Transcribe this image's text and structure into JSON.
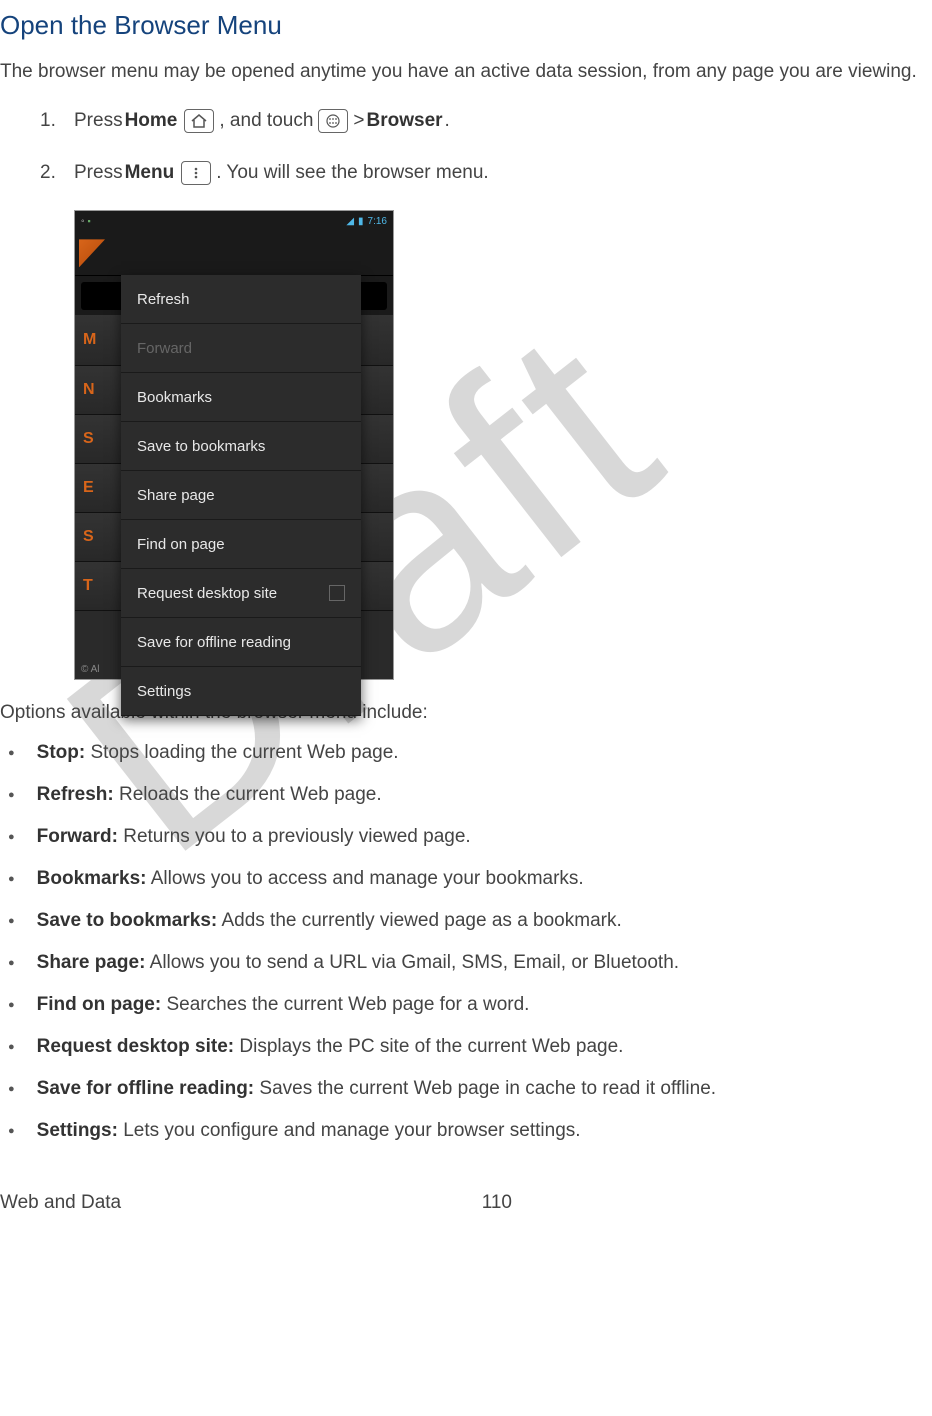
{
  "heading": "Open the Browser Menu",
  "intro": "The browser menu may be opened anytime you have an active data session, from any page you are viewing.",
  "steps": [
    {
      "num": "1.",
      "parts": [
        "Press ",
        {
          "bold": "Home"
        },
        " ",
        {
          "icon": "home"
        },
        ", and touch ",
        {
          "icon": "apps"
        },
        " > ",
        {
          "bold": "Browser"
        },
        "."
      ]
    },
    {
      "num": "2.",
      "parts": [
        "Press ",
        {
          "bold": "Menu"
        },
        " ",
        {
          "icon": "menu"
        },
        ". You will see the browser menu."
      ]
    }
  ],
  "screenshot": {
    "status_time": "7:16",
    "menu_items": [
      {
        "label": "Refresh",
        "disabled": false
      },
      {
        "label": "Forward",
        "disabled": true
      },
      {
        "label": "Bookmarks",
        "disabled": false
      },
      {
        "label": "Save to bookmarks",
        "disabled": false
      },
      {
        "label": "Share page",
        "disabled": false
      },
      {
        "label": "Find on page",
        "disabled": false
      },
      {
        "label": "Request desktop site",
        "disabled": false,
        "checkbox": true
      },
      {
        "label": "Save for offline reading",
        "disabled": false
      },
      {
        "label": "Settings",
        "disabled": false
      }
    ],
    "bg_rows": [
      "M",
      "N",
      "S",
      "E",
      "S",
      "T"
    ],
    "copyright": "©\nAl"
  },
  "subhead": "Options available within the browser menu include:",
  "options": [
    {
      "label": "Stop:",
      "desc": " Stops loading the current Web page."
    },
    {
      "label": "Refresh:",
      "desc": " Reloads the current Web page."
    },
    {
      "label": "Forward:",
      "desc": " Returns you to a previously viewed page."
    },
    {
      "label": "Bookmarks:",
      "desc": " Allows you to access and manage your bookmarks."
    },
    {
      "label": "Save to bookmarks:",
      "desc": " Adds the currently viewed page as a bookmark."
    },
    {
      "label": "Share page:",
      "desc": " Allows you to send a URL via Gmail, SMS, Email, or Bluetooth."
    },
    {
      "label": "Find on page:",
      "desc": " Searches the current Web page for a word."
    },
    {
      "label": "Request desktop site:",
      "desc": " Displays the PC site of the current Web page."
    },
    {
      "label": "Save for offline reading:",
      "desc": " Saves the current Web page in cache to read it offline."
    },
    {
      "label": "Settings:",
      "desc": " Lets you configure and manage your browser settings."
    }
  ],
  "footer": {
    "left": "Web and Data",
    "right": "110"
  },
  "watermark": "Draft"
}
